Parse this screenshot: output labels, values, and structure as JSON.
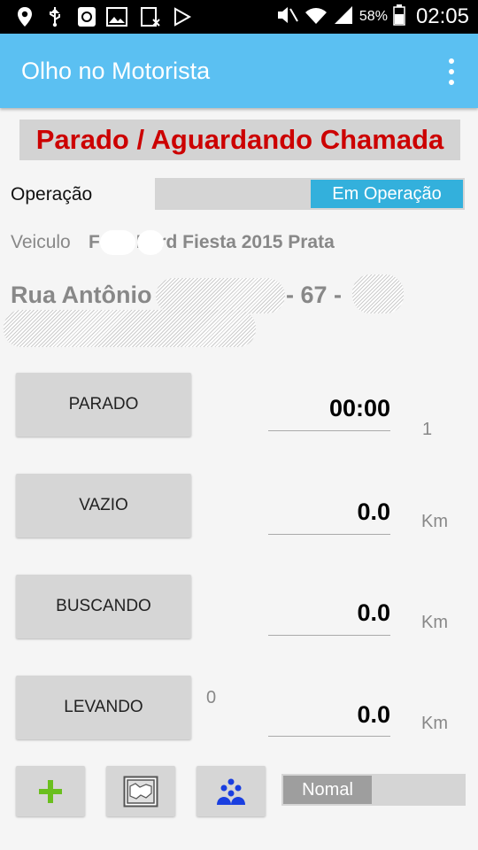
{
  "status_bar": {
    "battery": "58%",
    "time": "02:05",
    "left_icons": [
      "location-icon",
      "usb-icon",
      "phone-icon",
      "image-icon",
      "blocked-app-icon",
      "play-store-icon"
    ],
    "right_icons": [
      "mute-icon",
      "wifi-icon",
      "signal-icon",
      "battery-icon"
    ]
  },
  "appbar": {
    "title": "Olho no Motorista",
    "menu_icon": "overflow-menu-icon"
  },
  "banner": {
    "text": "Parado / Aguardando Chamada",
    "color": "#cc0000"
  },
  "operation": {
    "label": "Operação",
    "state": "Em Operação",
    "accent": "#33b0dc"
  },
  "vehicle": {
    "label": "Veiculo",
    "value": "F    1    9 Ford Fiesta 2015 Prata"
  },
  "address": {
    "street": "Rua Antônio",
    "number": "- 67 -"
  },
  "rows": [
    {
      "button": "PARADO",
      "value": "00:00",
      "unit": "1",
      "extra": ""
    },
    {
      "button": "VAZIO",
      "value": "0.0",
      "unit": "Km",
      "extra": ""
    },
    {
      "button": "BUSCANDO",
      "value": "0.0",
      "unit": "Km",
      "extra": ""
    },
    {
      "button": "LEVANDO",
      "value": "0.0",
      "unit": "Km",
      "extra": "0"
    }
  ],
  "bottom": {
    "icons": [
      "add-icon",
      "map-icon",
      "group-icon"
    ],
    "mode_label": "Nomal",
    "add_color": "#6abf1e",
    "group_color": "#1a3fe0"
  }
}
